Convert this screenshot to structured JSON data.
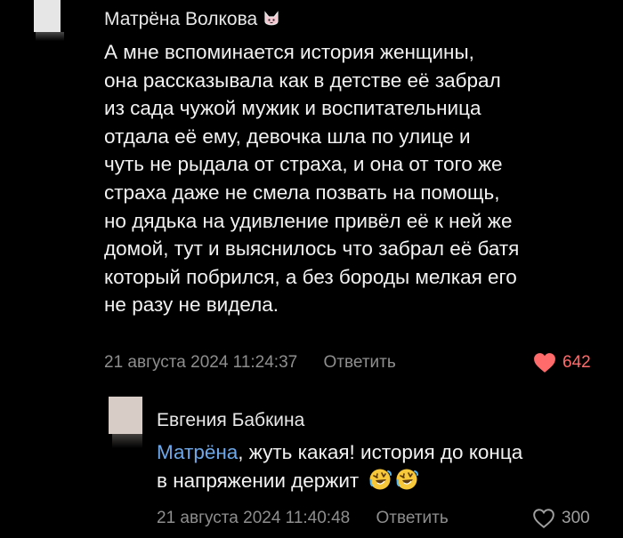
{
  "comment": {
    "author": "Матрёна Волкова",
    "lines": [
      "А мне вспоминается история женщины,",
      "она рассказывала как в детстве её забрал",
      "из сада чужой мужик и воспитательница",
      "отдала её ему, девочка шла по улице и",
      "чуть не рыдала от страха, и она от того же",
      "страха даже не смела позвать на помощь,",
      "но дядька на удивление привёл её к ней же",
      "домой, тут и выяснилось что забрал её батя",
      "который побрился, а без бороды мелкая его",
      "не разу не видела."
    ],
    "timestamp": "21 августа 2024 11:24:37",
    "reply_label": "Ответить",
    "likes": "642",
    "liked": true,
    "like_icon": "heart-filled-icon",
    "badge_icon": "cat-badge-icon"
  },
  "reply": {
    "author": "Евгения Бабкина",
    "mention": "Матрёна",
    "line1_rest": ", жуть какая! история до конца",
    "line2": "в напряжении держит",
    "emoji_icon": "rolling-laughing-emoji-icon",
    "timestamp": "21 августа 2024 11:40:48",
    "reply_label": "Ответить",
    "likes": "300",
    "liked": false,
    "like_icon": "heart-outline-icon"
  },
  "colors": {
    "background": "#000000",
    "text": "#f2f2f2",
    "meta": "#8e8e8e",
    "mention": "#6ea8e8",
    "like_active": "#ff6b6b"
  }
}
